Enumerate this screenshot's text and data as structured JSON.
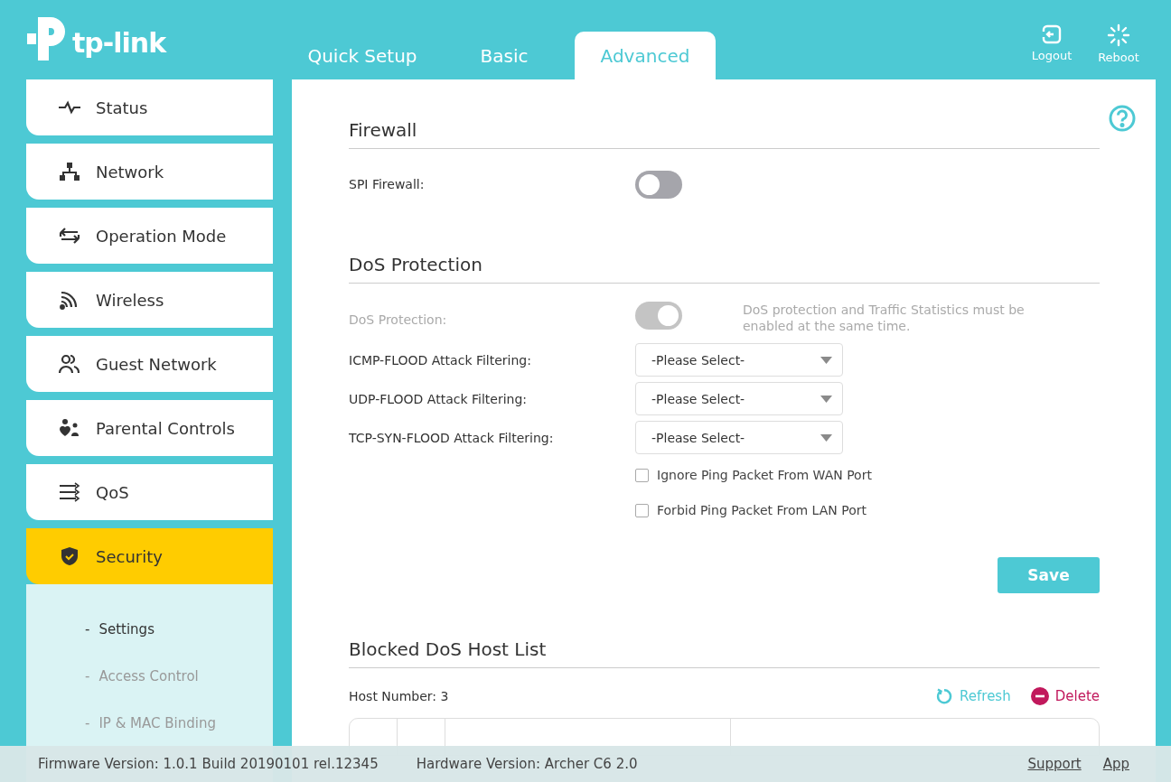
{
  "logo": {
    "text": "tp-link"
  },
  "tabs": [
    {
      "label": "Quick Setup",
      "selected": false
    },
    {
      "label": "Basic",
      "selected": false
    },
    {
      "label": "Advanced",
      "selected": true
    }
  ],
  "header_actions": [
    {
      "label": "Logout"
    },
    {
      "label": "Reboot"
    }
  ],
  "sidebar": {
    "items": [
      {
        "label": "Status",
        "selected": false
      },
      {
        "label": "Network",
        "selected": false
      },
      {
        "label": "Operation Mode",
        "selected": false
      },
      {
        "label": "Wireless",
        "selected": false
      },
      {
        "label": "Guest Network",
        "selected": false
      },
      {
        "label": "Parental Controls",
        "selected": false
      },
      {
        "label": "QoS",
        "selected": false
      },
      {
        "label": "Security",
        "selected": true,
        "children": [
          {
            "bullet": "-",
            "label": "Settings",
            "selected": true
          },
          {
            "bullet": "-",
            "label": "Access Control",
            "selected": false
          },
          {
            "bullet": "-",
            "label": "IP & MAC Binding",
            "selected": false
          }
        ]
      }
    ]
  },
  "firewall": {
    "title": "Firewall",
    "spi": {
      "label": "SPI Firewall:",
      "on": false,
      "disabled": false
    }
  },
  "dos": {
    "title": "DoS Protection",
    "toggle": {
      "label": "DoS Protection:",
      "on": true,
      "disabled": true,
      "note": "DoS protection and Traffic Statistics must be enabled at the same time."
    },
    "filters": [
      {
        "label": "ICMP-FLOOD Attack Filtering:",
        "value": "-Please Select-"
      },
      {
        "label": "UDP-FLOOD Attack Filtering:",
        "value": "-Please Select-"
      },
      {
        "label": "TCP-SYN-FLOOD Attack Filtering:",
        "value": "-Please Select-"
      }
    ],
    "checkboxes": [
      {
        "label": "Ignore Ping Packet From WAN Port",
        "checked": false
      },
      {
        "label": "Forbid Ping Packet From LAN Port",
        "checked": false
      }
    ],
    "save": "Save"
  },
  "blocked": {
    "title": "Blocked DoS Host List",
    "host_number": "Host Number: 3",
    "refresh": "Refresh",
    "delete": "Delete"
  },
  "footer": {
    "firmware": "Firmware Version: 1.0.1 Build 20190101 rel.12345",
    "hardware": "Hardware Version: Archer C6 2.0",
    "links": [
      "Support",
      "App"
    ]
  }
}
